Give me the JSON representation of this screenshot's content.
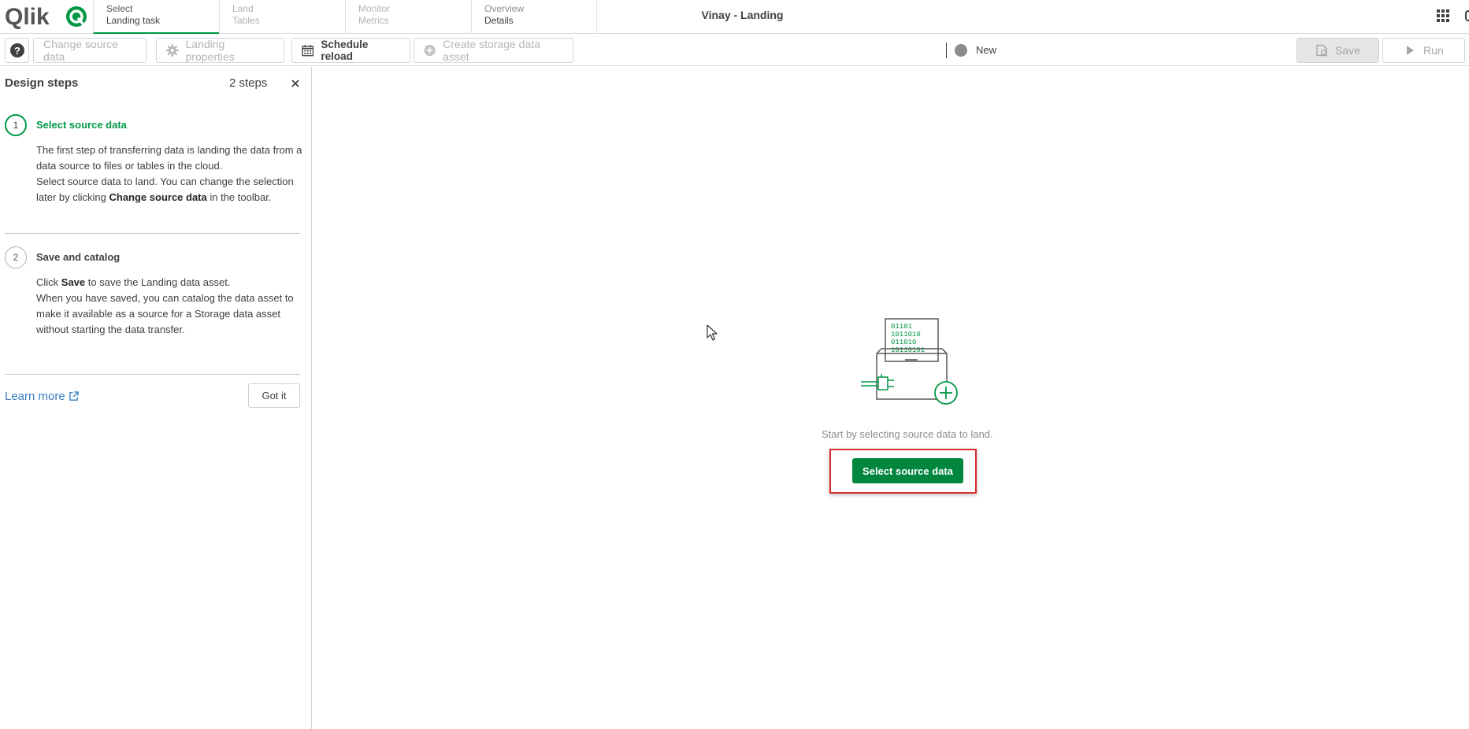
{
  "brand": {
    "logo_text": "Qlik",
    "accent": "#009845"
  },
  "nav": {
    "tabs": [
      {
        "line1": "Select",
        "line2": "Landing task"
      },
      {
        "line1": "Land",
        "line2": "Tables"
      },
      {
        "line1": "Monitor",
        "line2": "Metrics"
      },
      {
        "line1": "Overview",
        "line2": "Details"
      }
    ],
    "app_title": "Vinay - Landing"
  },
  "toolbar": {
    "change_source": "Change source data",
    "landing_properties": "Landing properties",
    "schedule_reload": "Schedule reload",
    "create_storage": "Create storage data asset",
    "status": "New",
    "save": "Save",
    "run": "Run"
  },
  "side_panel": {
    "title": "Design steps",
    "count": "2 steps",
    "steps": [
      {
        "number": "1",
        "title": "Select source data",
        "p1": "The first step of transferring data is landing the data from a data source to files or tables in the cloud.",
        "p2_a": "Select source data to land. You can change the selection later by clicking ",
        "p2_bold": "Change source data",
        "p2_b": " in the toolbar."
      },
      {
        "number": "2",
        "title": "Save and catalog",
        "p1_a": "Click ",
        "p1_bold": "Save",
        "p1_b": " to save the Landing data asset.",
        "p2": "When you have saved, you can catalog the data asset to make it available as a source for a Storage data asset without starting the data transfer."
      }
    ],
    "learn_more": "Learn more",
    "got_it": "Got it"
  },
  "main": {
    "illustration_lines": [
      "01101",
      "1011010",
      "011010",
      "10110101"
    ],
    "hint": "Start by selecting source data to land.",
    "primary_button": "Select source data"
  }
}
